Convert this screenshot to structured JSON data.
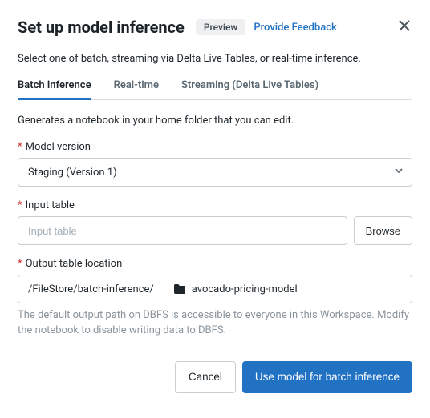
{
  "header": {
    "title": "Set up model inference",
    "badge": "Preview",
    "feedback": "Provide Feedback"
  },
  "subtitle": "Select one of batch, streaming via Delta Live Tables, or real-time inference.",
  "tabs": {
    "batch": "Batch inference",
    "realtime": "Real-time",
    "streaming": "Streaming (Delta Live Tables)"
  },
  "tab_desc": "Generates a notebook in your home folder that you can edit.",
  "fields": {
    "model_version": {
      "label": "Model version",
      "value": "Staging (Version 1)"
    },
    "input_table": {
      "label": "Input table",
      "placeholder": "Input table",
      "value": "",
      "browse": "Browse"
    },
    "output": {
      "label": "Output table location",
      "prefix": "/FileStore/batch-inference/",
      "name": "avocado-pricing-model",
      "helper": "The default output path on DBFS is accessible to everyone in this Workspace. Modify the notebook to disable writing data to DBFS."
    }
  },
  "footer": {
    "cancel": "Cancel",
    "submit": "Use model for batch inference"
  }
}
